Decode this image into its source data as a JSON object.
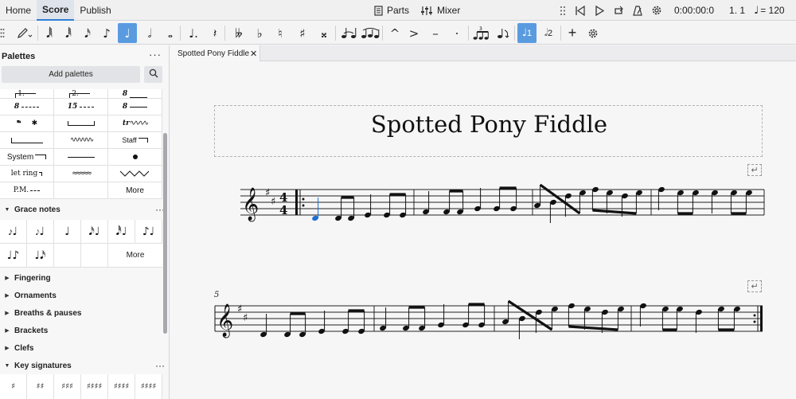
{
  "menu": {
    "tabs": [
      "Home",
      "Score",
      "Publish"
    ],
    "active_tab": "Score"
  },
  "header": {
    "parts_label": "Parts",
    "mixer_label": "Mixer",
    "time_display": "0:00:00:0",
    "position_display": "1. 1",
    "tempo_display": "= 120"
  },
  "toolbar": {
    "buttons": [
      "default-mode",
      "pencil",
      "64th-note",
      "32nd-note",
      "16th-note",
      "eighth-note",
      "quarter-note",
      "half-note",
      "whole-note",
      "augmentation-dot",
      "rest",
      "double-flat",
      "flat",
      "natural",
      "sharp",
      "double-sharp",
      "tie",
      "slur",
      "marcato",
      "accent",
      "tenuto",
      "staccato",
      "tuplet",
      "flip",
      "voice-1",
      "voice-2",
      "add",
      "customize"
    ],
    "voice_1_label": "1",
    "voice_2_label": "2"
  },
  "palettes": {
    "title": "Palettes",
    "add_button": "Add palettes",
    "lines_cells": [
      "1.",
      "2.",
      "8",
      "8",
      "15",
      "8",
      "",
      "",
      "",
      "",
      "",
      "Staff",
      "System",
      "",
      "",
      "let ring",
      "",
      "",
      "P.M.",
      "",
      "More"
    ],
    "sections": [
      {
        "label": "Grace notes",
        "expanded": true
      },
      {
        "label": "Fingering",
        "expanded": false
      },
      {
        "label": "Ornaments",
        "expanded": false
      },
      {
        "label": "Breaths & pauses",
        "expanded": false
      },
      {
        "label": "Brackets",
        "expanded": false
      },
      {
        "label": "Clefs",
        "expanded": false
      },
      {
        "label": "Key signatures",
        "expanded": true
      }
    ],
    "grace_more": "More"
  },
  "document": {
    "tab_title": "Spotted Pony Fiddle",
    "score_title": "Spotted Pony Fiddle",
    "measure_number_system2": "5",
    "time_signature": {
      "top": "4",
      "bottom": "4"
    },
    "key": "D major"
  },
  "colors": {
    "accent": "#2f7fd6",
    "active_button": "#5a9be0",
    "selected_note": "#1f6fd1"
  }
}
